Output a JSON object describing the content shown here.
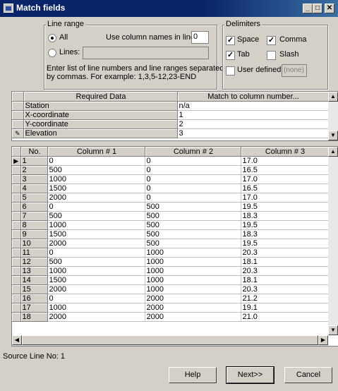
{
  "window": {
    "title": "Match fields",
    "minimize_glyph": "_",
    "maximize_glyph": "□",
    "close_glyph": "✕"
  },
  "line_range": {
    "legend": "Line range",
    "all_label": "All",
    "lines_label": "Lines:",
    "lines_value": "",
    "use_column_names_label": "Use column names in line",
    "use_column_names_value": "0",
    "help_text_1": "Enter list of line numbers and line ranges separated",
    "help_text_2": "by commas. For example: 1,3,5-12,23-END"
  },
  "delimiters": {
    "legend": "Delimiters",
    "space_label": "Space",
    "comma_label": "Comma",
    "tab_label": "Tab",
    "slash_label": "Slash",
    "user_defined_label": "User defined",
    "user_defined_value": "(none)",
    "check_glyph": "✓"
  },
  "mapping_table": {
    "col_required": "Required Data",
    "col_match": "Match to column number...",
    "edit_glyph": "✎",
    "rows": [
      {
        "label": "Station",
        "value": "n/a"
      },
      {
        "label": "X-coordinate",
        "value": "1"
      },
      {
        "label": "Y-coordinate",
        "value": "2"
      },
      {
        "label": "Elevation",
        "value": "3"
      }
    ]
  },
  "data_table": {
    "col_no": "No.",
    "col1": "Column # 1",
    "col2": "Column # 2",
    "col3": "Column # 3",
    "current_glyph": "▶",
    "rows": [
      [
        "1",
        "0",
        "0",
        "17.0"
      ],
      [
        "2",
        "500",
        "0",
        "16.5"
      ],
      [
        "3",
        "1000",
        "0",
        "17.0"
      ],
      [
        "4",
        "1500",
        "0",
        "16.5"
      ],
      [
        "5",
        "2000",
        "0",
        "17.0"
      ],
      [
        "6",
        "0",
        "500",
        "19.5"
      ],
      [
        "7",
        "500",
        "500",
        "18.3"
      ],
      [
        "8",
        "1000",
        "500",
        "19.5"
      ],
      [
        "9",
        "1500",
        "500",
        "18.3"
      ],
      [
        "10",
        "2000",
        "500",
        "19.5"
      ],
      [
        "11",
        "0",
        "1000",
        "20.3"
      ],
      [
        "12",
        "500",
        "1000",
        "18.1"
      ],
      [
        "13",
        "1000",
        "1000",
        "20.3"
      ],
      [
        "14",
        "1500",
        "1000",
        "18.1"
      ],
      [
        "15",
        "2000",
        "1000",
        "20.3"
      ],
      [
        "16",
        "0",
        "2000",
        "21.2"
      ],
      [
        "17",
        "1000",
        "2000",
        "19.1"
      ],
      [
        "18",
        "2000",
        "2000",
        "21.0"
      ]
    ]
  },
  "scroll": {
    "up": "▲",
    "down": "▼",
    "left": "◀",
    "right": "▶"
  },
  "status": {
    "source_line": "Source Line No: 1"
  },
  "buttons": {
    "help": "Help",
    "next": "Next>>",
    "cancel": "Cancel"
  }
}
